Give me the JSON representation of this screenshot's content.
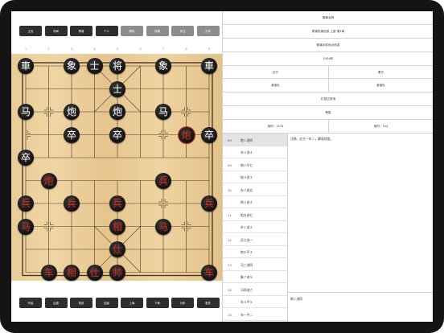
{
  "top_toolbar": [
    {
      "label": "主页",
      "style": "dark"
    },
    {
      "label": "导局",
      "style": "dark"
    },
    {
      "label": "棋谱",
      "style": "dark"
    },
    {
      "label": "个人",
      "style": "dark"
    },
    {
      "label": "联机",
      "style": "grey"
    },
    {
      "label": "设置",
      "style": "grey"
    },
    {
      "label": "评注",
      "style": "grey"
    },
    {
      "label": "分享",
      "style": "grey"
    }
  ],
  "file_labels_top": [
    "1",
    "2",
    "3",
    "4",
    "5",
    "6",
    "7",
    "8",
    "9"
  ],
  "file_labels_bottom": [
    "九",
    "八",
    "七",
    "六",
    "五",
    "四",
    "三",
    "二",
    "一"
  ],
  "pieces": [
    {
      "char": "車",
      "side": "black",
      "file": 0,
      "rank": 0
    },
    {
      "char": "象",
      "side": "black",
      "file": 2,
      "rank": 0
    },
    {
      "char": "士",
      "side": "black",
      "file": 3,
      "rank": 0
    },
    {
      "char": "将",
      "side": "black",
      "file": 4,
      "rank": 0
    },
    {
      "char": "象",
      "side": "black",
      "file": 6,
      "rank": 0
    },
    {
      "char": "車",
      "side": "black",
      "file": 8,
      "rank": 0
    },
    {
      "char": "士",
      "side": "black",
      "file": 4,
      "rank": 1
    },
    {
      "char": "马",
      "side": "black",
      "file": 0,
      "rank": 2
    },
    {
      "char": "炮",
      "side": "black",
      "file": 2,
      "rank": 2
    },
    {
      "char": "炮",
      "side": "black",
      "file": 4,
      "rank": 2
    },
    {
      "char": "马",
      "side": "black",
      "file": 6,
      "rank": 2
    },
    {
      "char": "卒",
      "side": "black",
      "file": 2,
      "rank": 3
    },
    {
      "char": "卒",
      "side": "black",
      "file": 4,
      "rank": 3
    },
    {
      "char": "炮",
      "side": "red",
      "file": 7,
      "rank": 3,
      "selected": true
    },
    {
      "char": "卒",
      "side": "black",
      "file": 8,
      "rank": 3
    },
    {
      "char": "卒",
      "side": "black",
      "file": 0,
      "rank": 4
    },
    {
      "char": "炮",
      "side": "red",
      "file": 1,
      "rank": 5
    },
    {
      "char": "兵",
      "side": "red",
      "file": 6,
      "rank": 5
    },
    {
      "char": "兵",
      "side": "red",
      "file": 0,
      "rank": 6
    },
    {
      "char": "兵",
      "side": "red",
      "file": 2,
      "rank": 6
    },
    {
      "char": "兵",
      "side": "red",
      "file": 4,
      "rank": 6
    },
    {
      "char": "兵",
      "side": "red",
      "file": 8,
      "rank": 6
    },
    {
      "char": "马",
      "side": "red",
      "file": 0,
      "rank": 7
    },
    {
      "char": "相",
      "side": "red",
      "file": 4,
      "rank": 7
    },
    {
      "char": "马",
      "side": "red",
      "file": 6,
      "rank": 7
    },
    {
      "char": "仕",
      "side": "red",
      "file": 4,
      "rank": 8
    },
    {
      "char": "车",
      "side": "red",
      "file": 1,
      "rank": 9
    },
    {
      "char": "相",
      "side": "red",
      "file": 2,
      "rank": 9
    },
    {
      "char": "仕",
      "side": "red",
      "file": 3,
      "rank": 9
    },
    {
      "char": "帅",
      "side": "red",
      "file": 4,
      "rank": 9
    },
    {
      "char": "车",
      "side": "red",
      "file": 8,
      "rank": 9
    }
  ],
  "bottom_toolbar": [
    "开始",
    "后退",
    "前进",
    "结束",
    "上局",
    "下局",
    "分析",
    "更多"
  ],
  "info": {
    "title": "赛事名称",
    "event": "棋谱来源信息 上册 第1局",
    "venue": "赛事对弈地点信息",
    "date": "1954年",
    "red_player_label": "红方",
    "black_player_label": "黑方",
    "red_team": "某某队",
    "black_team": "某某队",
    "opening": "红挺过宫炮",
    "result": "黑胜",
    "red_time": "用时：1h74",
    "black_time": "用时：1h3"
  },
  "moves": [
    {
      "num": "09",
      "text": "炮二进四",
      "active": true
    },
    {
      "num": "",
      "text": "车２进４",
      "active": false
    },
    {
      "num": "09",
      "text": "炮八平七",
      "active": false
    },
    {
      "num": "",
      "text": "炮３进３",
      "active": false
    },
    {
      "num": "10",
      "text": "车八进五",
      "active": false
    },
    {
      "num": "",
      "text": "炮３进４",
      "active": false
    },
    {
      "num": "11",
      "text": "相五进七",
      "active": false
    },
    {
      "num": "",
      "text": "卒１进２",
      "active": false
    },
    {
      "num": "12",
      "text": "兵七进一",
      "active": false
    },
    {
      "num": "",
      "text": "炮６平３",
      "active": false
    },
    {
      "num": "13",
      "text": "马三进四",
      "active": false
    },
    {
      "num": "",
      "text": "象７进５",
      "active": false
    },
    {
      "num": "14",
      "text": "马四进六",
      "active": false
    },
    {
      "num": "",
      "text": "车４平５",
      "active": false
    },
    {
      "num": "15",
      "text": "车一平二",
      "active": false
    }
  ],
  "comment": "注释。红方一车二，静观其变。",
  "current_move_note": "炮二进四"
}
